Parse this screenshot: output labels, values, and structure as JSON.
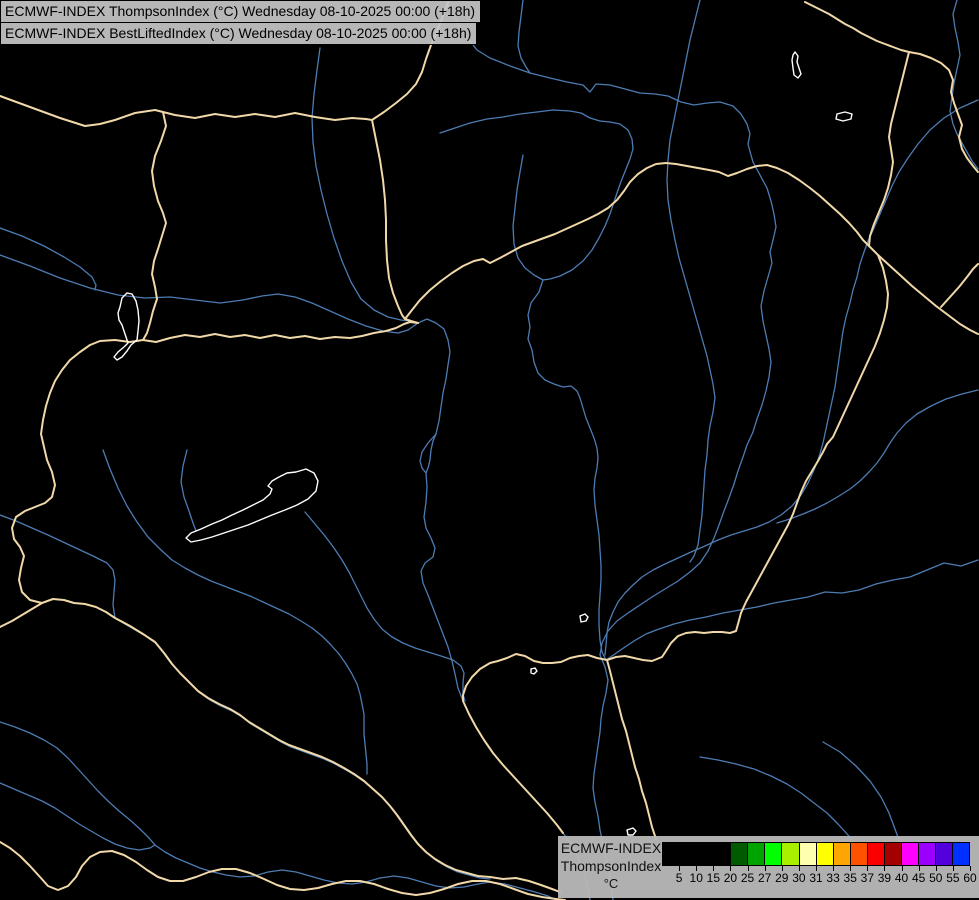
{
  "header": {
    "line1": "ECMWF-INDEX ThompsonIndex (°C) Wednesday 08-10-2025 00:00 (+18h)",
    "line2": "ECMWF-INDEX BestLiftedIndex (°C) Wednesday 08-10-2025 00:00 (+18h)"
  },
  "legend": {
    "title": "ECMWF-INDEX",
    "subtitle": "ThompsonIndex",
    "unit": "°C",
    "cells": [
      {
        "label": "5",
        "color": "#000000"
      },
      {
        "label": "10",
        "color": "#000000"
      },
      {
        "label": "15",
        "color": "#000000"
      },
      {
        "label": "20",
        "color": "#000000"
      },
      {
        "label": "25",
        "color": "#005a00"
      },
      {
        "label": "27",
        "color": "#00a400"
      },
      {
        "label": "29",
        "color": "#00ff00"
      },
      {
        "label": "30",
        "color": "#a8f000"
      },
      {
        "label": "31",
        "color": "#ffffb0"
      },
      {
        "label": "33",
        "color": "#ffff00"
      },
      {
        "label": "35",
        "color": "#ffa500"
      },
      {
        "label": "37",
        "color": "#ff5200"
      },
      {
        "label": "39",
        "color": "#fa0000"
      },
      {
        "label": "40",
        "color": "#a40000"
      },
      {
        "label": "45",
        "color": "#ff00ff"
      },
      {
        "label": "50",
        "color": "#9b00ff"
      },
      {
        "label": "55",
        "color": "#5200dd"
      },
      {
        "label": "60",
        "color": "#0030ff"
      }
    ]
  },
  "map": {
    "colors": {
      "background": "#000000",
      "border": "#f0d8a8",
      "river": "#4d7cb3",
      "lake": "#ffffff"
    },
    "rivers": [
      "0,255 30,266 60,278 90,288 118,295 145,298 170,297 195,300 220,303 243,300 262,296 278,294 295,297 312,303 330,311 348,319 366,326 383,331 398,333 408,330 415,325 418,323",
      "0,228 22,236 44,246 64,257 80,267 92,277 96,285 95,290",
      "418,323 427,319 436,323 444,329 448,340 450,352 448,365 446,379 443,393 441,407 439,421 436,434 428,443 422,452 420,461 422,468 426,473 427,487 426,502 424,517 426,528 431,538 435,548 433,557 425,563 421,571 423,583 428,595 433,608 438,621 443,634 448,647 452,661 455,674 458,688 463,701 469,714 476,727 484,740 493,753 503,765 514,777 525,789 536,801 547,813 557,825 566,837 574,849 580,862 585,875 588,888 590,900",
      "436,434 433,441 431,450 430,460 428,468 426,473",
      "320,48 317,70 314,94 312,118 313,142 316,166 321,190 327,214 334,238 342,261 351,282 361,299 374,310 388,317 401,320 410,321 418,323",
      "445,0 455,18 466,36 477,50 490,58 510,66 530,73 550,78 567,82 583,85 590,92 596,84 610,85 625,89 640,93 655,94 668,96 681,102 694,105 707,103 720,102 733,106 741,114 747,124 750,134 748,144 751,155 753,162",
      "523,0 521,16 519,32 518,46 521,58 526,67 530,73",
      "440,133 455,128 470,123 487,119 503,117 520,114 537,112 553,110 570,111 581,113 590,118 600,121 610,122 620,124 628,130 632,139 633,149 630,159 626,169 622,179 618,190 614,202 610,214 605,226 599,238 592,250 583,261 572,270 560,276 550,279 543,280",
      "523,155 520,172 517,190 515,208 513,226 514,244 518,258 525,268 534,275 543,280 539,292 531,303 528,315 530,327 528,339 532,350 534,362 538,373 545,380 554,384 563,387 571,386 577,391 580,398 583,408 586,418 590,428 594,438 597,448 598,458 597,468 595,478 594,490 595,505 597,520 599,535 600,550 601,565 601,580 600,595 599,610 599,625 600,640 602,652 606,660",
      "700,0 695,20 690,40 686,60 682,80 678,100 674,120 670,140 668,160 667,180 668,200 671,220 675,240 679,258 683,272 687,286 691,300 695,314 699,328 703,342 707,356 710,370 713,384 715,398 713,412 710,426 708,440 707,455 705,470 704,485 703,500 702,515 700,530 698,545 694,556 690,562",
      "753,162 760,175 767,188 771,201 774,214 776,227 773,240 770,252 772,263 768,277 764,291 761,306 763,321 766,335 769,349 771,362 769,377 766,391 762,405 757,419 753,432 747,445 743,457 738,471 734,484 729,498 724,511 719,525 714,538 708,551 700,563 690,572 678,581 665,589 652,597 640,605 628,613 617,621 608,631 602,643 600,655 605,667 608,680 606,693 603,706 601,719 600,732 598,746 596,760 594,774 593,788 595,802 598,816 600,830 603,844 606,858 609,872 611,886 613,900",
      "978,100 960,108 944,118 930,130 918,144 908,158 899,172 892,186 886,200 880,214 874,228 868,241 864,252 860,264 857,277 853,290 850,303 846,317 843,331 841,345 839,359 837,373 835,387 832,401 829,415 826,429 823,443 819,457 814,470 808,483 801,495 792,506 781,515 769,522 757,527 744,531 731,535 718,540 705,546 691,552 678,558 665,564 653,570 642,577 633,585 625,593 618,602 613,612 609,622 607,633 606,645 605,655",
      "957,0 953,14 955,28 958,42 960,55 957,69 954,83 952,97 950,111 953,124 957,134 962,143 967,152 972,161 978,169",
      "978,390 962,394 946,399 931,406 917,414 906,423 897,433 890,443 884,453 877,463 869,472 860,481 850,489 839,496 827,503 815,509 803,514 790,519 777,523",
      "978,560 961,566 944,563 927,570 910,577 893,580 876,584 859,590 842,593 825,592 808,597 791,600 774,603 757,607 740,610 723,613 706,617 690,620 674,624 659,629 646,634 634,641 622,649 612,656 606,660",
      "700,757 718,760 736,764 754,769 771,776 787,784 801,793 814,803 827,813 838,824 848,835 855,843",
      "823,742 840,752 856,766 870,781 881,797 889,813 895,829 900,843",
      "0,722 15,727 30,733 44,740 57,748 68,758 78,769 88,780 98,791 108,801 119,811 130,820 140,829 149,838 155,845",
      "0,783 14,789 28,795 42,801 55,808 67,816 79,824 91,831 103,838 115,844 127,848 139,850 150,848 155,845",
      "155,845 165,852 176,858 188,863 200,868 213,872 226,875 240,877 254,876 268,872 282,870 296,872 310,876 324,880 338,883 352,884 366,882 380,878 394,876 408,878 422,882 436,886 450,888 464,887 478,884 490,882 505,884 520,888 535,892 548,896 556,900",
      "187,450 183,466 181,482 184,497 189,511 193,523 196,531",
      "305,512 315,524 325,536 334,548 342,560 349,572 355,584 361,596 367,608 374,619 382,629 392,637 403,643 415,648 428,652 441,656 453,660 461,666 464,673 463,683 463,694 465,701",
      "103,450 110,469 118,488 127,506 137,522 148,537 160,549 172,560 185,568 198,575 211,581 224,586 237,591 250,596 263,602 276,608 289,614 301,621 312,628 322,636 331,645 339,654 346,664 352,674 357,684 360,694 362,704 364,714 364,724 364,734 365,744 366,754 367,764 367,774",
      "0,515 16,521 32,528 48,535 63,542 78,549 93,556 107,563 113,570 115,580 114,592 113,605 115,618",
      "115,618 130,627 144,635 157,644 166,655 174,666 182,675 191,684 200,693 210,700 221,706 232,711 242,717 251,724 261,730 271,736 281,742 291,747 302,751 313,755 324,759 335,764 346,770 356,776 366,783 375,791 384,799 392,808 399,817 406,827 413,837 420,846 428,854 437,861 447,867 458,872 469,875 480,878 490,879"
    ],
    "borders": [
      "0,96 30,107 60,118 85,126 100,124 115,120 135,113 155,110 175,115 195,118 215,114 235,117 255,114 275,117 295,113 315,117 335,120 352,118 366,119 372,120",
      "372,120 384,112 396,103 407,94 416,84 422,72 426,59 431,45 437,31 443,16 449,0",
      "372,120 376,140 380,160 383,180 385,200 386,220 386,240 387,260 389,278 393,293 398,306 402,315 405,319 411,321 418,323",
      "143,340 156,342 170,338 185,335 200,337 215,334 230,337 245,335 260,338 275,335 290,338 305,336 320,339 335,337 350,338 362,336 374,333 386,331 396,328 404,324 410,322 418,323",
      "163,112 166,126 161,141 155,156 152,171 154,186 158,201 163,213 166,223 162,236 158,249 154,261 152,274 155,287 157,299 153,311 150,323 147,333 143,340",
      "143,340 130,342 115,340 100,341 90,345 80,352 70,360 62,370 55,381 50,393 46,406 43,420 41,434 44,447 47,460 52,472 55,485 52,497 45,503 35,507 25,511 16,517 12,528 14,539 20,547 24,556 21,568 19,580 22,592 30,600 42,603",
      "42,603 32,609 22,615 12,621 0,627",
      "42,603 53,599 64,600 74,603 85,604 96,607 106,612 115,618 130,626 143,634 155,642 164,653 172,664 180,673 189,682 198,691 208,698 219,704 230,709 240,715 249,722 259,728 269,734 279,740 289,745 300,749 311,753 322,757 333,762 344,768 354,774 364,781 373,789 382,797 390,806 397,815 404,825 411,835 418,844 426,852 435,859 445,865 456,870 467,873 478,876 490,877 503,879 516,878 529,881 541,885 552,889 560,892",
      "0,842 10,848 20,856 30,866 40,877 48,886 58,890 68,886 76,877 82,866 90,857 100,852 112,851 124,855 136,862 147,870 158,877 170,881 183,881 196,877 209,872 222,869 236,869 250,873 264,879 277,885 290,889 304,890 318,888 332,884 346,881 360,881 374,884 388,889 402,893 416,895 430,893 444,889 458,884 472,881 486,881 500,884 514,889 528,894 542,897 556,899 565,900",
      "405,319 412,310 420,300 430,290 441,281 452,273 463,266 474,261 483,259 490,263 500,258 511,252 522,246 533,242 544,238 555,234 566,229 577,224 588,219 598,214 608,208 617,200 624,191 630,182 638,174 647,168 656,164 666,163 676,164 687,166 698,168 709,170 719,172 728,176 737,173 747,169 757,166 767,165 777,168 788,173 799,180 810,188 820,196 830,205 840,214 849,223 857,232 863,240 869,246",
      "805,2 813,6 821,10 829,14 837,19 845,24 853,28 861,33 869,37 877,41 885,44 893,47 901,50 909,52",
      "909,52 920,54 931,58 941,63 949,70 953,80 951,92 954,103 958,114 962,125 959,137 962,149 967,158 973,166 978,172",
      "909,52 906,64 903,76 900,88 897,100 894,112 891,124 889,137 891,149 893,162 891,175 888,188 884,200 879,212 874,224 870,236 869,246",
      "869,246 878,255 889,265 900,275 912,286 924,296 936,306 948,315 960,324 970,330 978,334",
      "941,307 950,297 959,287 967,277 973,269 978,264",
      "878,255 883,268 886,281 888,294 887,307 884,320 880,333 875,346 869,359 863,372 857,385 851,398 845,411 839,424 833,437 827,444 823,452 818,461 812,471 806,481 801,492 797,503 793,514 788,525 782,536 776,547 770,558 764,569 758,580 752,591 746,602 741,613 738,624 736,631 730,633 722,632 713,632 704,633 695,632 686,633 678,636 671,643 666,651 662,657 652,661 643,660 634,658 625,656 616,657 607,660",
      "607,660 597,658 588,655 579,656 570,658 561,662 552,663 543,663 534,661 525,656 516,654 507,658 498,661 490,663 480,669 472,677 466,686 463,695 463,701 469,714 476,727 484,740 493,753 503,765 514,777 525,789 536,801 547,813 557,825 563,833",
      "607,660 610,671 613,683 616,695 619,707 622,719 626,731 629,743 632,755 635,767 639,779 642,791 646,803 649,815 652,827 656,839"
    ],
    "lakes": [
      "127,293 122,298 120,307 118,313 119,320 122,325 124,331 126,337 128,343 124,347 118,352 114,357 117,360 122,357 127,351 131,345 137,340 138,331 139,321 138,310 136,301 132,294 127,293",
      "296,472 306,469 314,473 318,481 316,491 308,499 297,505 285,510 272,515 260,520 248,525 236,529 224,533 212,537 201,540 191,542 186,538 191,533 201,529 212,524 222,520 232,515 243,510 253,505 263,500 270,494 272,489 268,486 272,481 279,477 287,473 296,472",
      "795,52 798,56 797,62 799,68 801,74 798,78 794,75 793,68 792,60 793,55 795,52",
      "837,114 845,112 852,114 851,119 843,121 836,119 837,114",
      "580,616 585,614 588,617 586,621 581,622 580,616",
      "531,669 535,668 537,671 534,674 531,673 531,669",
      "627,830 633,828 636,831 633,835 628,835 627,830"
    ]
  }
}
